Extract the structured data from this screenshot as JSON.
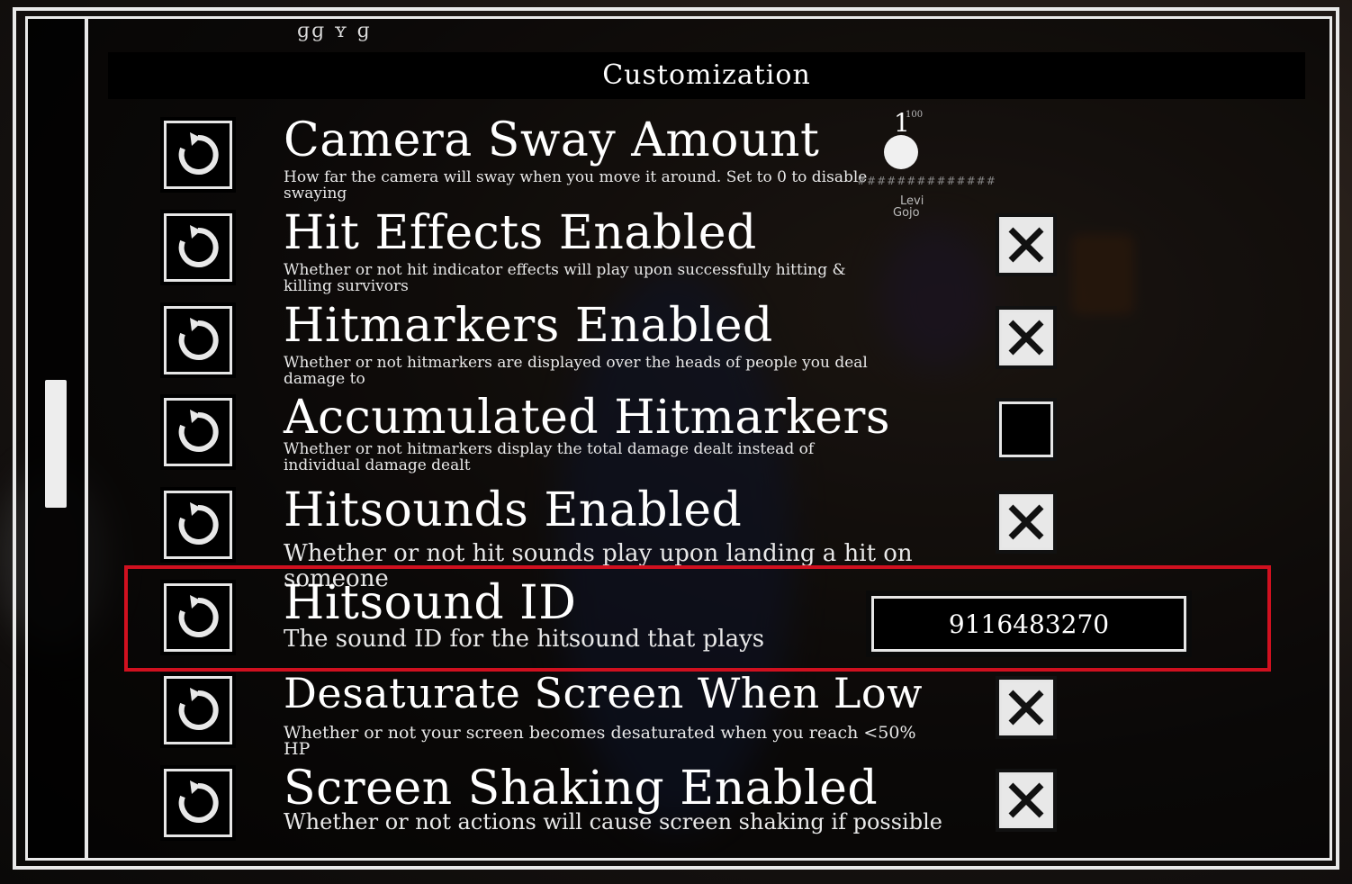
{
  "header": {
    "top_partial_text": "ɡɡ                    ʏ   ɡ",
    "title": "Customization"
  },
  "background_tags": {
    "name1": "Levi",
    "name2": "Gojo"
  },
  "settings": [
    {
      "title": "Camera Sway Amount",
      "description": "How far the camera will sway when you move it around. Set to 0 to disable swaying",
      "control": "slider",
      "slider_value": "1",
      "slider_max": "100",
      "slider_track": "##############"
    },
    {
      "title": "Hit Effects Enabled",
      "description": "Whether or not hit indicator effects will play upon successfully hitting & killing survivors",
      "control": "toggle",
      "checked": true
    },
    {
      "title": "Hitmarkers Enabled",
      "description": "Whether or not hitmarkers are displayed over the heads of people you deal damage to",
      "control": "toggle",
      "checked": true
    },
    {
      "title": "Accumulated Hitmarkers",
      "description": "Whether or not hitmarkers display the total damage dealt instead of individual damage dealt",
      "control": "toggle",
      "checked": false
    },
    {
      "title": "Hitsounds Enabled",
      "description": "Whether or not hit sounds play upon landing a hit on someone",
      "control": "toggle",
      "checked": true
    },
    {
      "title": "Hitsound ID",
      "description": "The sound ID for the hitsound that plays",
      "control": "text-input",
      "value": "9116483270"
    },
    {
      "title": "Desaturate Screen When Low",
      "description": "Whether or not your screen becomes desaturated when you reach <50% HP",
      "control": "toggle",
      "checked": true
    },
    {
      "title": "Screen Shaking Enabled",
      "description": "Whether or not actions will cause screen shaking if possible",
      "control": "toggle",
      "checked": true
    }
  ],
  "icons": {
    "reset": "reset-arrow-icon",
    "checked": "x-mark-icon"
  },
  "colors": {
    "highlight": "#d0101f",
    "frame": "#e9e9e9",
    "panel": "#000000"
  }
}
